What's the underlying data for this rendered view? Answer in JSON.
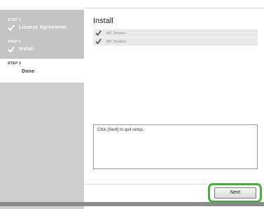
{
  "sidebar": {
    "steps": [
      {
        "number": "STEP 1",
        "label": "License Agreement",
        "status": "completed"
      },
      {
        "number": "STEP 2",
        "label": "Install",
        "status": "completed"
      },
      {
        "number": "STEP 3",
        "label": "Done",
        "status": "current"
      }
    ]
  },
  "main": {
    "title": "Install",
    "items": [
      {
        "label": "MF Drivers",
        "icon": "check-icon"
      },
      {
        "label": "MF Toolbox",
        "icon": "check-icon"
      }
    ],
    "message": "Click [Next] to quit setup."
  },
  "footer": {
    "next_label": "Next",
    "highlight_color": "#44b035"
  },
  "colors": {
    "sidebar_bg": "#cfcfcf",
    "list_item_bg": "#e9e9e9",
    "bottom_bar": "#8a8a8a"
  }
}
